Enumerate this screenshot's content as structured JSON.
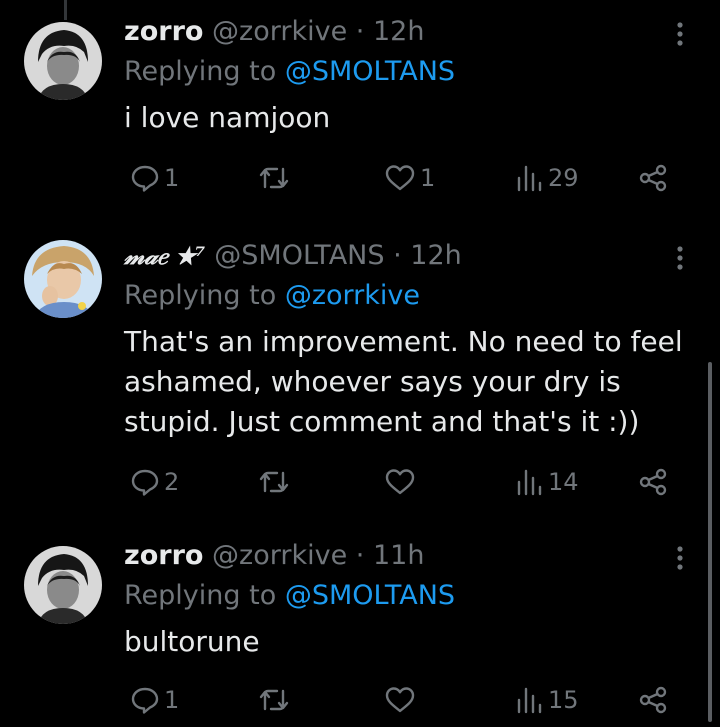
{
  "tweets": [
    {
      "name": "zorro",
      "handle": "@zorrkive",
      "separator": "·",
      "time": "12h",
      "replying_prefix": "Replying to",
      "replying_to": "@SMOLTANS",
      "text": "i love namjoon",
      "counts": {
        "replies": "1",
        "retweets": "",
        "likes": "1",
        "views": "29"
      }
    },
    {
      "name": "𝓂𝒶𝑒 ★⁷",
      "handle": "@SMOLTANS",
      "separator": "·",
      "time": "12h",
      "replying_prefix": "Replying to",
      "replying_to": "@zorrkive",
      "text": "That's an improvement. No need to feel ashamed, whoever says your dry is stupid. Just comment and that's it :))",
      "counts": {
        "replies": "2",
        "retweets": "",
        "likes": "",
        "views": "14"
      }
    },
    {
      "name": "zorro",
      "handle": "@zorrkive",
      "separator": "·",
      "time": "11h",
      "replying_prefix": "Replying to",
      "replying_to": "@SMOLTANS",
      "text": "bultorune",
      "counts": {
        "replies": "1",
        "retweets": "",
        "likes": "",
        "views": "15"
      }
    }
  ],
  "icons": [
    "more-icon",
    "reply-icon",
    "retweet-icon",
    "like-icon",
    "views-icon",
    "share-icon"
  ],
  "colors": {
    "background": "#000000",
    "text": "#e7e9ea",
    "muted": "#71767b",
    "link": "#1d9bf0"
  }
}
